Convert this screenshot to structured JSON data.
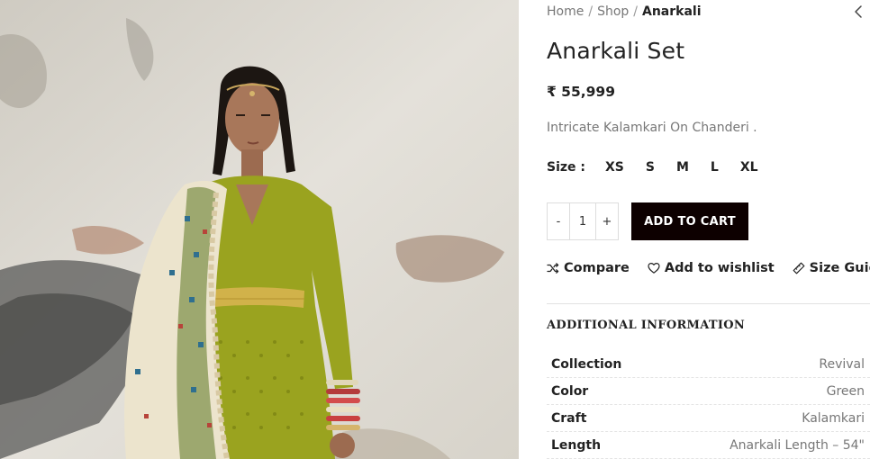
{
  "breadcrumb": {
    "items": [
      "Home",
      "Shop"
    ],
    "current": "Anarkali",
    "separator": "/"
  },
  "product": {
    "title": "Anarkali Set",
    "price": "₹ 55,999",
    "description": "Intricate Kalamkari On Chanderi ."
  },
  "sizes": {
    "label": "Size :",
    "options": [
      "XS",
      "S",
      "M",
      "L",
      "XL"
    ]
  },
  "quantity": {
    "decrement": "-",
    "value": "1",
    "increment": "+"
  },
  "cart": {
    "add_label": "ADD TO CART"
  },
  "actions": {
    "compare": "Compare",
    "wishlist": "Add to wishlist",
    "size_guide": "Size Guide"
  },
  "additional_info": {
    "title": "ADDITIONAL INFORMATION",
    "rows": [
      {
        "key": "Collection",
        "value": "Revival"
      },
      {
        "key": "Color",
        "value": "Green"
      },
      {
        "key": "Craft",
        "value": "Kalamkari"
      },
      {
        "key": "Length",
        "value": "Anarkali Length – 54\""
      }
    ]
  },
  "icons": {
    "back": "chevron-left-icon",
    "compare": "shuffle-icon",
    "wishlist": "heart-icon",
    "size_guide": "ruler-icon"
  },
  "colors": {
    "cart_button": "#0d0000",
    "muted_text": "#777777",
    "dress": "#9aa31f"
  }
}
